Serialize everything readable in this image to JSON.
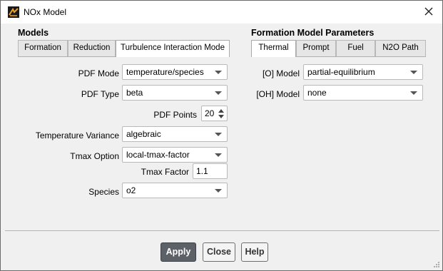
{
  "window": {
    "title": "NOx Model",
    "app_icon": "fluent-app-icon",
    "close_icon": "close-icon"
  },
  "models": {
    "heading": "Models",
    "tabs": [
      {
        "label": "Formation",
        "active": false
      },
      {
        "label": "Reduction",
        "active": false
      },
      {
        "label": "Turbulence Interaction Mode",
        "active": true
      }
    ],
    "fields": {
      "pdf_mode": {
        "label": "PDF Mode",
        "value": "temperature/species"
      },
      "pdf_type": {
        "label": "PDF Type",
        "value": "beta"
      },
      "pdf_points": {
        "label": "PDF Points",
        "value": "20"
      },
      "temperature_variance": {
        "label": "Temperature Variance",
        "value": "algebraic"
      },
      "tmax_option": {
        "label": "Tmax Option",
        "value": "local-tmax-factor"
      },
      "tmax_factor": {
        "label": "Tmax Factor",
        "value": "1.1"
      },
      "species": {
        "label": "Species",
        "value": "o2"
      }
    }
  },
  "formation": {
    "heading": "Formation Model Parameters",
    "tabs": [
      {
        "label": "Thermal",
        "active": true
      },
      {
        "label": "Prompt",
        "active": false
      },
      {
        "label": "Fuel",
        "active": false
      },
      {
        "label": "N2O Path",
        "active": false
      }
    ],
    "fields": {
      "o_model": {
        "label": "[O] Model",
        "value": "partial-equilibrium"
      },
      "oh_model": {
        "label": "[OH] Model",
        "value": "none"
      }
    }
  },
  "buttons": {
    "apply": "Apply",
    "close": "Close",
    "help": "Help"
  },
  "colors": {
    "primary_button": "#5d6168",
    "window_bg": "#f0f0f0",
    "titlebar_bg": "#ffffff"
  }
}
